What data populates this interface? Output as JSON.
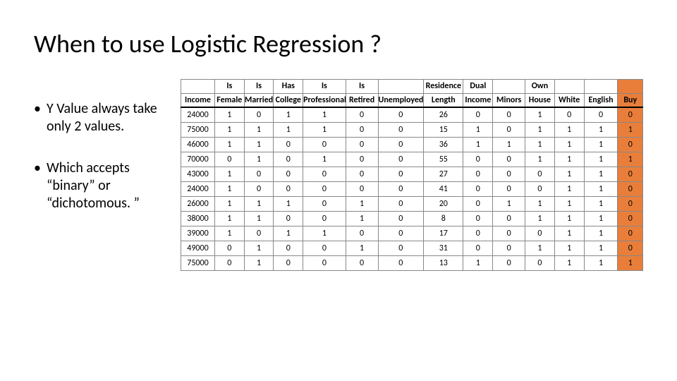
{
  "title": "When to use Logistic Regression ?",
  "bullets": [
    "Y Value always take only 2 values.",
    "Which accepts “binary” or “dichotomous. ”"
  ],
  "chart_data": {
    "type": "table",
    "headers_top": [
      "",
      "Is",
      "Is",
      "Has",
      "Is",
      "Is",
      "",
      "Residence",
      "Dual",
      "",
      "Own",
      "",
      "",
      ""
    ],
    "headers_bottom": [
      "Income",
      "Female",
      "Married",
      "College",
      "Professional",
      "Retired",
      "Unemployed",
      "Length",
      "Income",
      "Minors",
      "House",
      "White",
      "English",
      "Buy"
    ],
    "rows": [
      [
        24000,
        1,
        0,
        1,
        1,
        0,
        0,
        26,
        0,
        0,
        1,
        0,
        0,
        0
      ],
      [
        75000,
        1,
        1,
        1,
        1,
        0,
        0,
        15,
        1,
        0,
        1,
        1,
        1,
        1
      ],
      [
        46000,
        1,
        1,
        0,
        0,
        0,
        0,
        36,
        1,
        1,
        1,
        1,
        1,
        0
      ],
      [
        70000,
        0,
        1,
        0,
        1,
        0,
        0,
        55,
        0,
        0,
        1,
        1,
        1,
        1
      ],
      [
        43000,
        1,
        0,
        0,
        0,
        0,
        0,
        27,
        0,
        0,
        0,
        1,
        1,
        0
      ],
      [
        24000,
        1,
        0,
        0,
        0,
        0,
        0,
        41,
        0,
        0,
        0,
        1,
        1,
        0
      ],
      [
        26000,
        1,
        1,
        1,
        0,
        1,
        0,
        20,
        0,
        1,
        1,
        1,
        1,
        0
      ],
      [
        38000,
        1,
        1,
        0,
        0,
        1,
        0,
        8,
        0,
        0,
        1,
        1,
        1,
        0
      ],
      [
        39000,
        1,
        0,
        1,
        1,
        0,
        0,
        17,
        0,
        0,
        0,
        1,
        1,
        0
      ],
      [
        49000,
        0,
        1,
        0,
        0,
        1,
        0,
        31,
        0,
        0,
        1,
        1,
        1,
        0
      ],
      [
        75000,
        0,
        1,
        0,
        0,
        0,
        0,
        13,
        1,
        0,
        0,
        1,
        1,
        1
      ]
    ]
  }
}
